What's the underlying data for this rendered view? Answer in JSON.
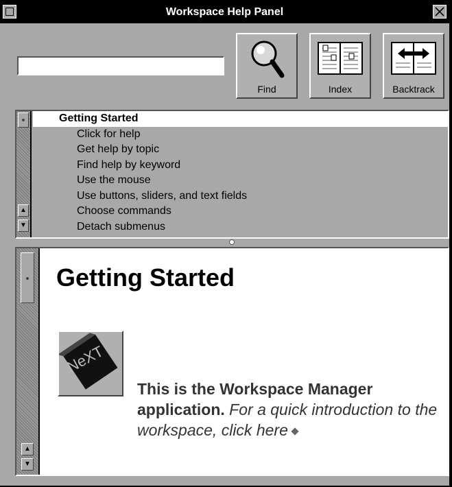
{
  "window": {
    "title": "Workspace Help Panel"
  },
  "search": {
    "value": "",
    "placeholder": ""
  },
  "toolbar": {
    "find_label": "Find",
    "index_label": "Index",
    "backtrack_label": "Backtrack"
  },
  "topics": {
    "selected": "Getting Started",
    "items": [
      "Click for help",
      "Get help by topic",
      "Find help by keyword",
      "Use the mouse",
      "Use buttons, sliders, and text fields",
      "Choose commands",
      "Detach submenus"
    ]
  },
  "content": {
    "heading": "Getting Started",
    "logo_text": "NeXT",
    "para_bold": "This is the Workspace Manager application.",
    "para_italic": " For a quick introduction to the workspace, click here"
  },
  "icons": [
    "close-icon",
    "miniaturize-icon",
    "magnifier-icon",
    "book-icon",
    "backtrack-book-icon",
    "scroll-up-icon",
    "scroll-down-icon",
    "link-diamond-icon"
  ]
}
